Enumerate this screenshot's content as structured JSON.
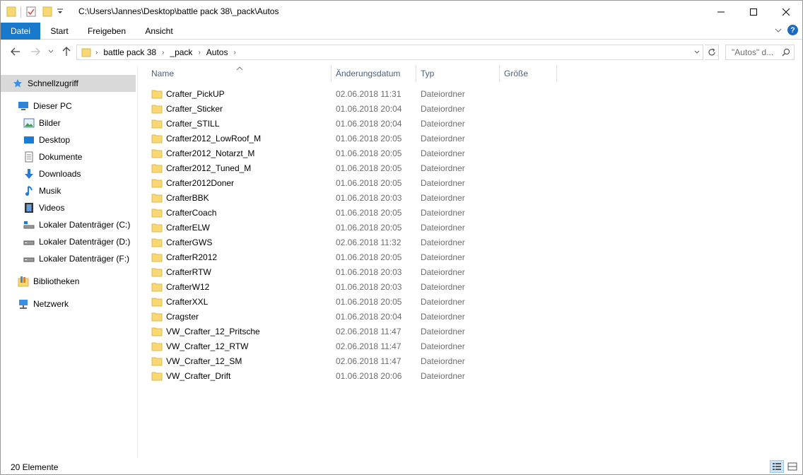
{
  "window": {
    "title_path": "C:\\Users\\Jannes\\Desktop\\battle pack 38\\_pack\\Autos"
  },
  "ribbon": {
    "tabs": [
      "Datei",
      "Start",
      "Freigeben",
      "Ansicht"
    ],
    "help_label": "?"
  },
  "navigation": {
    "breadcrumbs": [
      "battle pack 38",
      "_pack",
      "Autos"
    ],
    "search_placeholder": "\"Autos\" d..."
  },
  "sidebar": {
    "quick_access": "Schnellzugriff",
    "this_pc": "Dieser PC",
    "pc_items": [
      "Bilder",
      "Desktop",
      "Dokumente",
      "Downloads",
      "Musik",
      "Videos",
      "Lokaler Datenträger (C:)",
      "Lokaler Datenträger (D:)",
      "Lokaler Datenträger (F:)"
    ],
    "libraries": "Bibliotheken",
    "network": "Netzwerk"
  },
  "filelist": {
    "columns": [
      "Name",
      "Änderungsdatum",
      "Typ",
      "Größe"
    ],
    "rows": [
      {
        "name": "Crafter_PickUP",
        "date": "02.06.2018 11:31",
        "type": "Dateiordner"
      },
      {
        "name": "Crafter_Sticker",
        "date": "01.06.2018 20:04",
        "type": "Dateiordner"
      },
      {
        "name": "Crafter_STILL",
        "date": "01.06.2018 20:04",
        "type": "Dateiordner"
      },
      {
        "name": "Crafter2012_LowRoof_M",
        "date": "01.06.2018 20:05",
        "type": "Dateiordner"
      },
      {
        "name": "Crafter2012_Notarzt_M",
        "date": "01.06.2018 20:05",
        "type": "Dateiordner"
      },
      {
        "name": "Crafter2012_Tuned_M",
        "date": "01.06.2018 20:05",
        "type": "Dateiordner"
      },
      {
        "name": "Crafter2012Doner",
        "date": "01.06.2018 20:05",
        "type": "Dateiordner"
      },
      {
        "name": "CrafterBBK",
        "date": "01.06.2018 20:03",
        "type": "Dateiordner"
      },
      {
        "name": "CrafterCoach",
        "date": "01.06.2018 20:05",
        "type": "Dateiordner"
      },
      {
        "name": "CrafterELW",
        "date": "01.06.2018 20:05",
        "type": "Dateiordner"
      },
      {
        "name": "CrafterGWS",
        "date": "02.06.2018 11:32",
        "type": "Dateiordner"
      },
      {
        "name": "CrafterR2012",
        "date": "01.06.2018 20:05",
        "type": "Dateiordner"
      },
      {
        "name": "CrafterRTW",
        "date": "01.06.2018 20:03",
        "type": "Dateiordner"
      },
      {
        "name": "CrafterW12",
        "date": "01.06.2018 20:03",
        "type": "Dateiordner"
      },
      {
        "name": "CrafterXXL",
        "date": "01.06.2018 20:05",
        "type": "Dateiordner"
      },
      {
        "name": "Cragster",
        "date": "01.06.2018 20:04",
        "type": "Dateiordner"
      },
      {
        "name": "VW_Crafter_12_Pritsche",
        "date": "02.06.2018 11:47",
        "type": "Dateiordner"
      },
      {
        "name": "VW_Crafter_12_RTW",
        "date": "02.06.2018 11:47",
        "type": "Dateiordner"
      },
      {
        "name": "VW_Crafter_12_SM",
        "date": "02.06.2018 11:47",
        "type": "Dateiordner"
      },
      {
        "name": "VW_Crafter_Drift",
        "date": "01.06.2018 20:06",
        "type": "Dateiordner"
      }
    ]
  },
  "status": {
    "item_count": "20 Elemente"
  },
  "colors": {
    "accent": "#1979ca",
    "folder": "#f8d775",
    "selected_nav": "#d9d9d9"
  }
}
